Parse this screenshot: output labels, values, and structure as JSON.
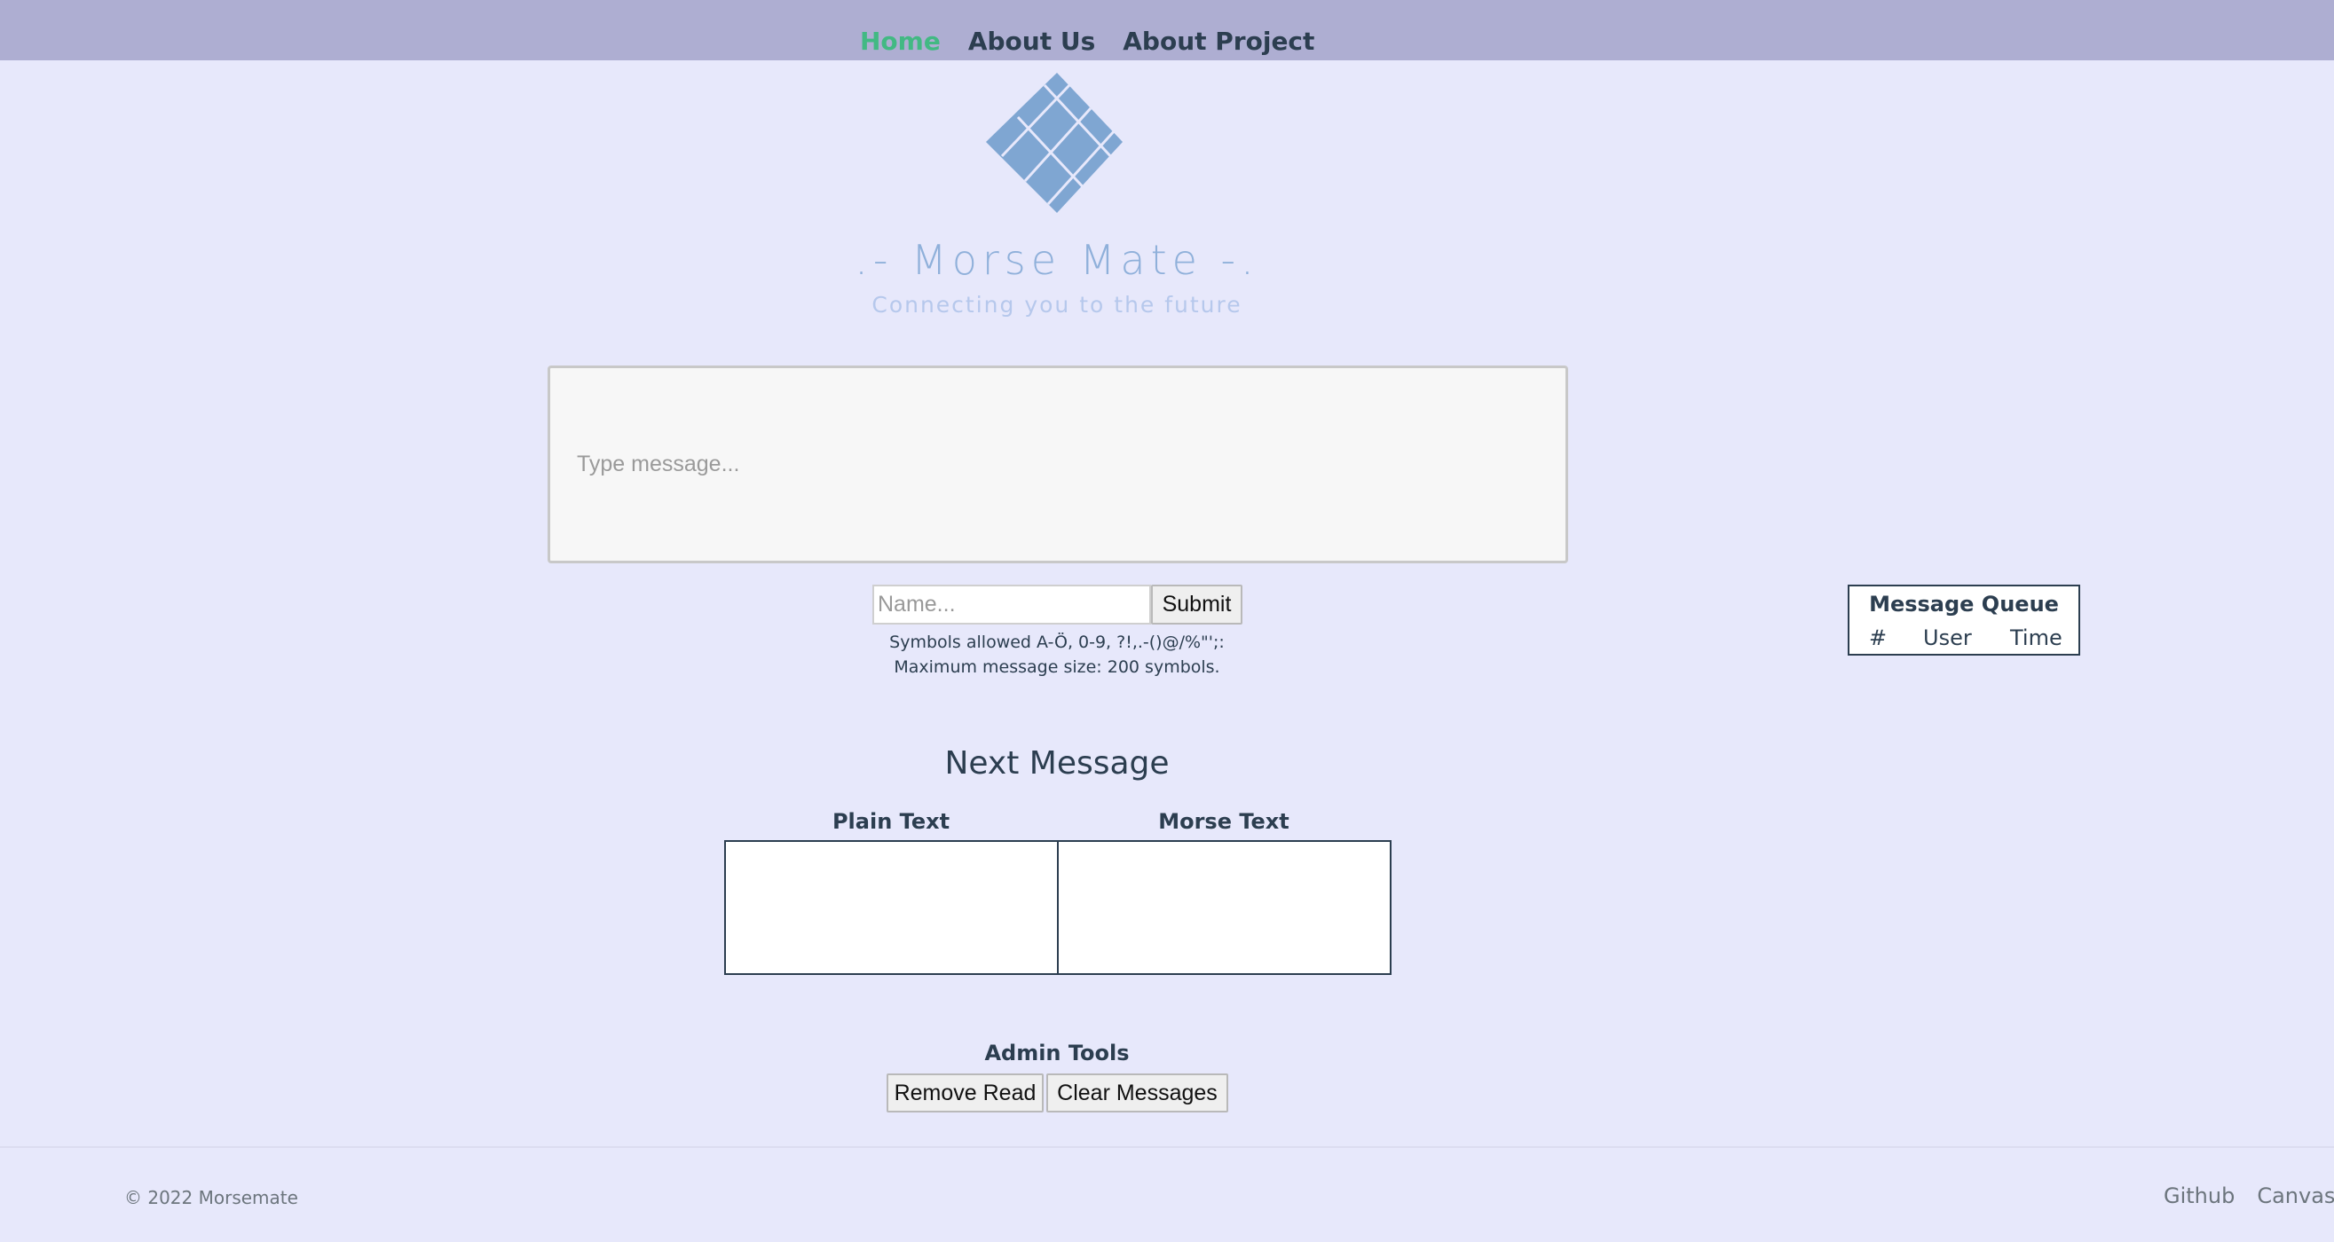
{
  "nav": {
    "items": [
      {
        "label": "Home",
        "active": true
      },
      {
        "label": "About Us",
        "active": false
      },
      {
        "label": "About Project",
        "active": false
      }
    ]
  },
  "brand": {
    "title": ".- Morse Mate -.",
    "subtitle": "Connecting you to the future"
  },
  "compose": {
    "message_placeholder": "Type message...",
    "name_placeholder": "Name...",
    "submit_label": "Submit",
    "hint_symbols": "Symbols allowed A-Ö, 0-9, ?!,.-()@/%\"';:",
    "hint_size": "Maximum message size: 200 symbols."
  },
  "queue": {
    "title": "Message Queue",
    "columns": [
      "#",
      "User",
      "Time"
    ]
  },
  "next_message": {
    "title": "Next Message",
    "plain_header": "Plain Text",
    "morse_header": "Morse Text",
    "plain_value": "",
    "morse_value": ""
  },
  "admin": {
    "title": "Admin Tools",
    "remove_label": "Remove Read",
    "clear_label": "Clear Messages"
  },
  "footer": {
    "copyright": "© 2022 Morsemate",
    "links": [
      "Github",
      "Canvas"
    ]
  },
  "colors": {
    "nav_bar": "#aeaed2",
    "background": "#e7e8fb",
    "active_link": "#42b983",
    "text": "#2c3e50",
    "logo": "#7fa6d2"
  }
}
